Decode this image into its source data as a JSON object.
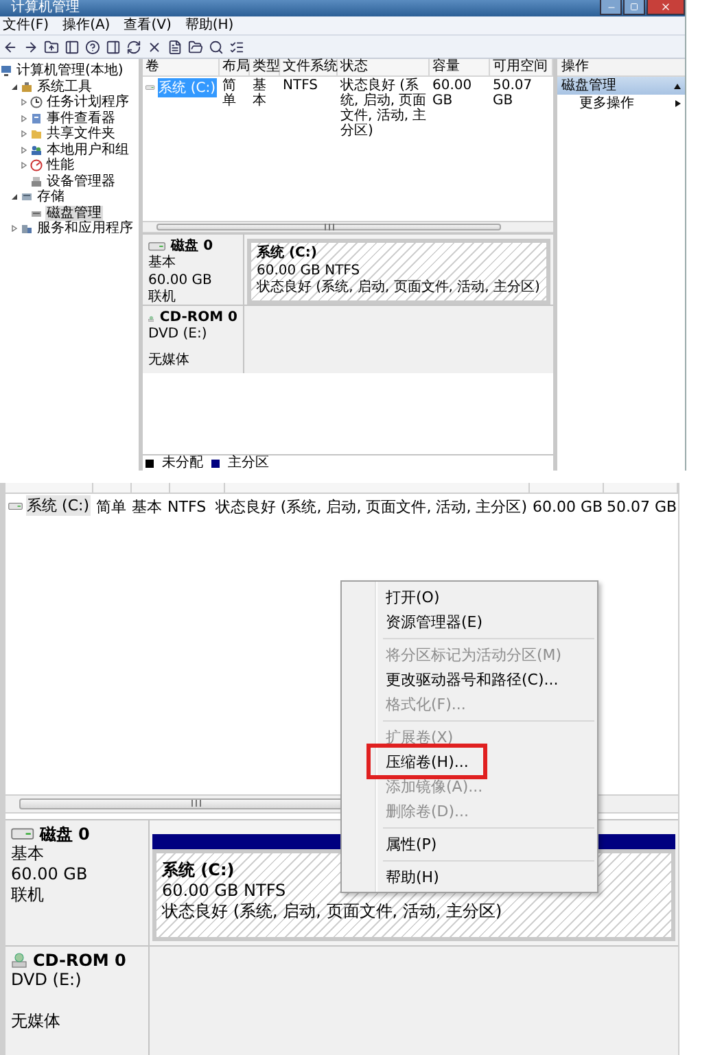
{
  "top": {
    "window": {
      "title": "计算机管理"
    },
    "menu": [
      "文件(F)",
      "操作(A)",
      "查看(V)",
      "帮助(H)"
    ],
    "tree": [
      {
        "label": "计算机管理(本地)",
        "selected": false,
        "children": [
          {
            "label": "系统工具",
            "expanded": true,
            "selected": false,
            "children": [
              {
                "label": "任务计划程序",
                "expanded": false,
                "selected": false
              },
              {
                "label": "事件查看器",
                "expanded": false,
                "selected": false
              },
              {
                "label": "共享文件夹",
                "expanded": false,
                "selected": false
              },
              {
                "label": "本地用户和组",
                "expanded": false,
                "selected": false
              },
              {
                "label": "性能",
                "expanded": false,
                "selected": false
              },
              {
                "label": "设备管理器",
                "selected": false
              }
            ]
          },
          {
            "label": "存储",
            "expanded": true,
            "selected": false,
            "children": [
              {
                "label": "磁盘管理",
                "selected": true
              }
            ]
          },
          {
            "label": "服务和应用程序",
            "expanded": false,
            "selected": false
          }
        ]
      }
    ],
    "volume_table": {
      "columns": [
        "卷",
        "布局",
        "类型",
        "文件系统",
        "状态",
        "容量",
        "可用空间"
      ],
      "rows": [
        {
          "selected": true,
          "cells": [
            "系统 (C:)",
            "简单",
            "基本",
            "NTFS",
            "状态良好 (系统, 启动, 页面文件, 活动, 主分区)",
            "60.00 GB",
            "50.07 GB"
          ]
        }
      ]
    },
    "disks": [
      {
        "kind": "disk",
        "name": "磁盘 0",
        "type": "基本",
        "size": "60.00 GB",
        "status": "联机",
        "partition": {
          "name": "系统 (C:)",
          "size": "60.00 GB NTFS",
          "status": "状态良好 (系统, 启动, 页面文件, 活动, 主分区)"
        }
      },
      {
        "kind": "cdrom",
        "name": "CD-ROM 0",
        "drive": "DVD (E:)",
        "status": "无媒体"
      }
    ],
    "legend": [
      {
        "label": "未分配",
        "color": "#000000"
      },
      {
        "label": "主分区",
        "color": "#000080"
      }
    ],
    "actions": {
      "header": "操作",
      "section": "磁盘管理",
      "items": [
        "更多操作"
      ]
    }
  },
  "bottom": {
    "volume_row": {
      "selected": true,
      "cells": [
        "系统 (C:)",
        "简单",
        "基本",
        "NTFS",
        "状态良好 (系统, 启动, 页面文件, 活动, 主分区)",
        "60.00 GB",
        "50.07 GB"
      ]
    },
    "context_menu": [
      {
        "kind": "item",
        "label": "打开(O)",
        "disabled": false,
        "highlighted": false
      },
      {
        "kind": "item",
        "label": "资源管理器(E)",
        "disabled": false,
        "highlighted": false
      },
      {
        "kind": "separator"
      },
      {
        "kind": "item",
        "label": "将分区标记为活动分区(M)",
        "disabled": true,
        "highlighted": false
      },
      {
        "kind": "item",
        "label": "更改驱动器号和路径(C)...",
        "disabled": false,
        "highlighted": false
      },
      {
        "kind": "item",
        "label": "格式化(F)...",
        "disabled": true,
        "highlighted": false
      },
      {
        "kind": "separator"
      },
      {
        "kind": "item",
        "label": "扩展卷(X)",
        "disabled": true,
        "highlighted": false
      },
      {
        "kind": "item",
        "label": "压缩卷(H)...",
        "disabled": false,
        "highlighted": true
      },
      {
        "kind": "item",
        "label": "添加镜像(A)...",
        "disabled": true,
        "highlighted": false
      },
      {
        "kind": "item",
        "label": "删除卷(D)...",
        "disabled": true,
        "highlighted": false
      },
      {
        "kind": "separator"
      },
      {
        "kind": "item",
        "label": "属性(P)",
        "disabled": false,
        "highlighted": false
      },
      {
        "kind": "separator"
      },
      {
        "kind": "item",
        "label": "帮助(H)",
        "disabled": false,
        "highlighted": false
      }
    ],
    "disks": [
      {
        "kind": "disk",
        "name": "磁盘 0",
        "type": "基本",
        "size": "60.00 GB",
        "status": "联机",
        "partition": {
          "name": "系统 (C:)",
          "size": "60.00 GB NTFS",
          "status": "状态良好 (系统, 启动, 页面文件, 活动, 主分区)"
        }
      },
      {
        "kind": "cdrom",
        "name": "CD-ROM 0",
        "drive": "DVD (E:)",
        "status": "无媒体"
      }
    ]
  }
}
